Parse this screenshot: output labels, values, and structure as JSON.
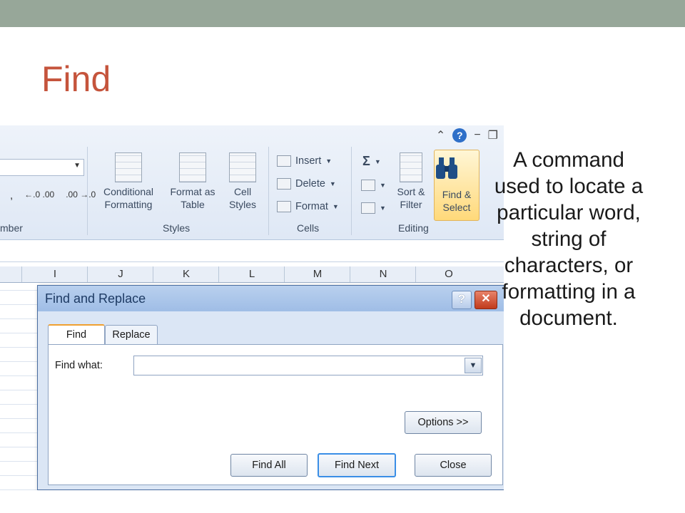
{
  "slide": {
    "title": "Find",
    "description": "A command used to locate a particular word, string of characters, or formatting in a document."
  },
  "ribbon": {
    "number_group_label": "mber",
    "number_symbols": [
      ",",
      "←.0 .00",
      ".00 →.0"
    ],
    "styles": {
      "label": "Styles",
      "buttons": [
        "Conditional Formatting",
        "Format as Table",
        "Cell Styles"
      ]
    },
    "cells": {
      "label": "Cells",
      "buttons": [
        "Insert",
        "Delete",
        "Format"
      ]
    },
    "editing": {
      "label": "Editing",
      "sum_symbol": "Σ",
      "sort": "Sort & Filter",
      "find": "Find & Select"
    },
    "window_controls": [
      "⌃",
      "?",
      "−",
      "❐"
    ]
  },
  "sheet": {
    "columns": [
      "I",
      "J",
      "K",
      "L",
      "M",
      "N",
      "O"
    ]
  },
  "dialog": {
    "title": "Find and Replace",
    "help": "?",
    "close": "✕",
    "tabs": [
      "Find",
      "Replace"
    ],
    "find_what_label": "Find what:",
    "find_what_value": "",
    "options_button": "Options >>",
    "buttons": {
      "find_all": "Find All",
      "find_next": "Find Next",
      "close": "Close"
    }
  }
}
